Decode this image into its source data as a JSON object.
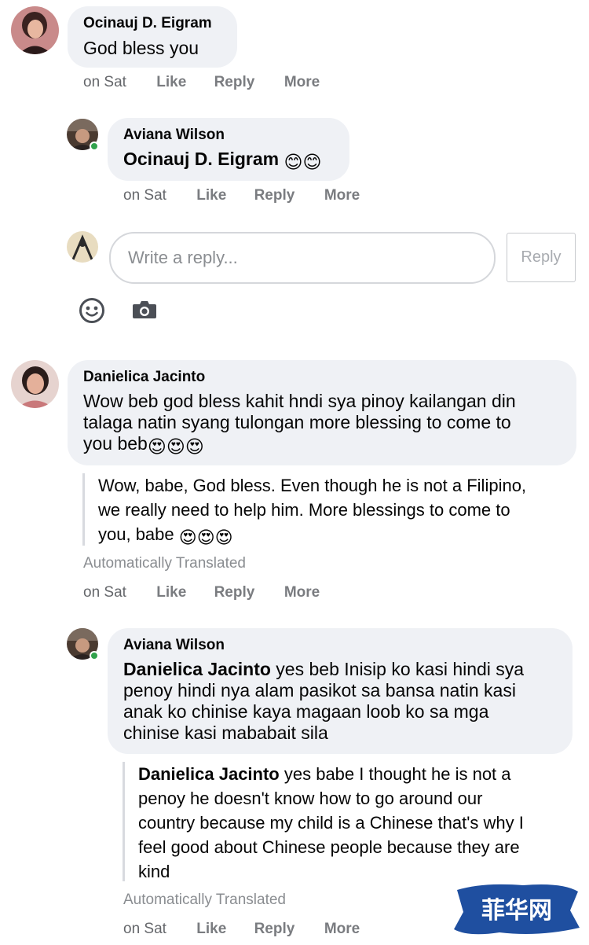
{
  "comments": [
    {
      "author": "Ocinauj D. Eigram",
      "text": "God bless you",
      "time": "on Sat",
      "actions": [
        "Like",
        "Reply",
        "More"
      ]
    },
    {
      "author": "Aviana Wilson",
      "mention": "Ocinauj D. Eigram",
      "emoji": "😊😊",
      "time": "on Sat",
      "actions": [
        "Like",
        "Reply",
        "More"
      ]
    },
    {
      "author": "Danielica Jacinto",
      "text_lines": [
        "Wow beb god bless kahit hndi sya pinoy kailangan din",
        "talaga natin syang tulongan more blessing to come to",
        "you beb"
      ],
      "emoji": "😍😍😍",
      "translation_lines": [
        "Wow, babe, God bless. Even though he is not a Filipino,",
        "we really need to help him. More blessings to come to",
        "you, babe"
      ],
      "translation_emoji": "😍😍😍",
      "auto_translated": "Automatically Translated",
      "time": "on Sat",
      "actions": [
        "Like",
        "Reply",
        "More"
      ]
    },
    {
      "author": "Aviana Wilson",
      "mention": "Danielica Jacinto",
      "text_lines": [
        " yes beb Inisip ko kasi hindi sya",
        "penoy hindi nya alam pasikot sa bansa natin kasi",
        "anak ko chinise kaya magaan loob ko sa mga",
        "chinise kasi mababait sila"
      ],
      "translation_mention": "Danielica Jacinto",
      "translation_lines": [
        " yes babe I thought he is not a",
        "penoy he doesn't know how to go around our",
        "country because my child is a Chinese that's why I",
        "feel good about Chinese people because they are",
        "kind"
      ],
      "auto_translated": "Automatically Translated",
      "time": "on Sat",
      "actions": [
        "Like",
        "Reply",
        "More"
      ]
    }
  ],
  "reply_box": {
    "placeholder": "Write a reply...",
    "button": "Reply",
    "icons": [
      "smiley-icon",
      "camera-icon"
    ]
  },
  "watermark": {
    "text": "菲华网",
    "color": "#1f4fa0"
  },
  "colors": {
    "bubble": "#eff1f5",
    "meta": "#65676b",
    "online": "#31a24c"
  }
}
